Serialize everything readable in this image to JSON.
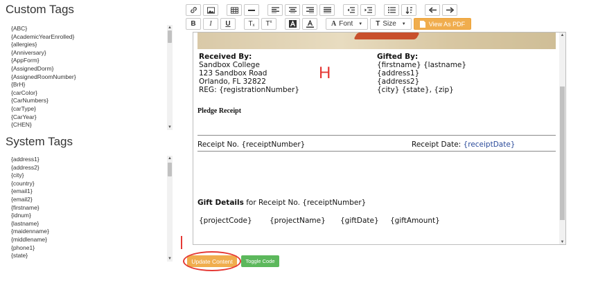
{
  "custom_tags": {
    "title": "Custom Tags",
    "items": [
      "{ABC}",
      "{AcademicYearEnrolled}",
      "{allergies}",
      "{Anniversary}",
      "{AppForm}",
      "{AssignedDorm}",
      "{AssignedRoomNumber}",
      "{BrH}",
      "{carColor}",
      "{CarNumbers}",
      "{carType}",
      "{CarYear}",
      "{CHEN}"
    ]
  },
  "system_tags": {
    "title": "System Tags",
    "items": [
      "{address1}",
      "{address2}",
      "{city}",
      "{country}",
      "{email1}",
      "{email2}",
      "{firstname}",
      "{idnum}",
      "{lastname}",
      "{maidenname}",
      "{middlename}",
      "{phone1}",
      "{state}"
    ]
  },
  "toolbar": {
    "font_label": "Font",
    "size_label": "Size",
    "pdf_label": "View As PDF",
    "bold": "B",
    "italic": "I",
    "underline": "U",
    "subscript": "T",
    "superscript": "T"
  },
  "document": {
    "received_heading": "Received By:",
    "received_lines": [
      "Sandbox College",
      "123 Sandbox Road",
      "Orlando, FL 32822",
      "REG: {registrationNumber}"
    ],
    "gifted_heading": "Gifted By:",
    "gifted_lines": [
      "{firstname} {lastname}",
      "{address1}",
      "{address2}",
      "{city} {state}, {zip}"
    ],
    "pledge_title": "Pledge Receipt",
    "receipt_no": "Receipt No. {receiptNumber}",
    "receipt_date_label": "Receipt Date:",
    "receipt_date_value": "{receiptDate}",
    "gift_details_bold": "Gift Details",
    "gift_details_rest": " for Receipt No. {receiptNumber}",
    "fields": [
      "{projectCode}",
      "{projectName}",
      "{giftDate}",
      "{giftAmount}"
    ]
  },
  "annotations": {
    "h_mark": "H",
    "i_mark": "I"
  },
  "buttons": {
    "update": "Update Content",
    "toggle": "Toggle Code"
  }
}
